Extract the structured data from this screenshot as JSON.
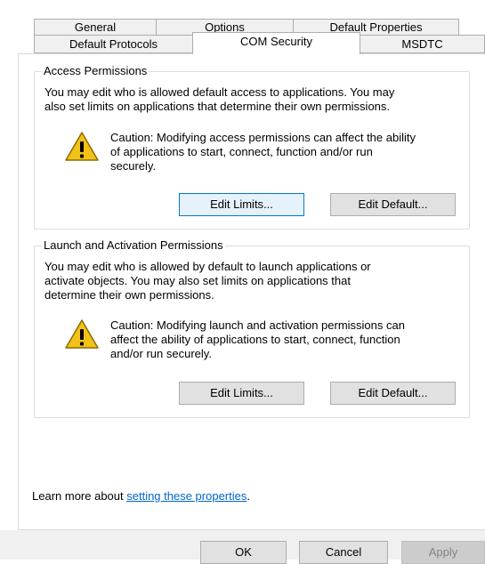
{
  "tabs": {
    "row1": [
      "General",
      "Options",
      "Default Properties"
    ],
    "row2": [
      "Default Protocols",
      "COM Security",
      "MSDTC"
    ],
    "active": "COM Security"
  },
  "access": {
    "title": "Access Permissions",
    "description": [
      "You may edit who is allowed default access to applications. You may",
      "also set limits on applications that determine their own permissions."
    ],
    "caution": [
      "Caution: Modifying access permissions can affect the ability",
      "of applications to start, connect, function and/or run",
      "securely."
    ],
    "edit_limits": "Edit Limits...",
    "edit_default": "Edit Default..."
  },
  "launch": {
    "title": "Launch and Activation Permissions",
    "description": [
      "You may edit who is allowed by default to launch applications or",
      "activate objects. You may also set limits on applications that",
      "determine their own permissions."
    ],
    "caution": [
      "Caution: Modifying launch and activation permissions can",
      "affect the ability of applications to start, connect, function",
      "and/or run securely."
    ],
    "edit_limits": "Edit Limits...",
    "edit_default": "Edit Default..."
  },
  "learn_more": {
    "prefix": "Learn more about ",
    "link": "setting these properties",
    "suffix": "."
  },
  "dialog": {
    "ok": "OK",
    "cancel": "Cancel",
    "apply": "Apply"
  },
  "icons": {
    "warning": "warning-icon"
  },
  "colors": {
    "link": "#0066cc",
    "focus_border": "#0078d7",
    "warning_fill": "#f2c218"
  }
}
